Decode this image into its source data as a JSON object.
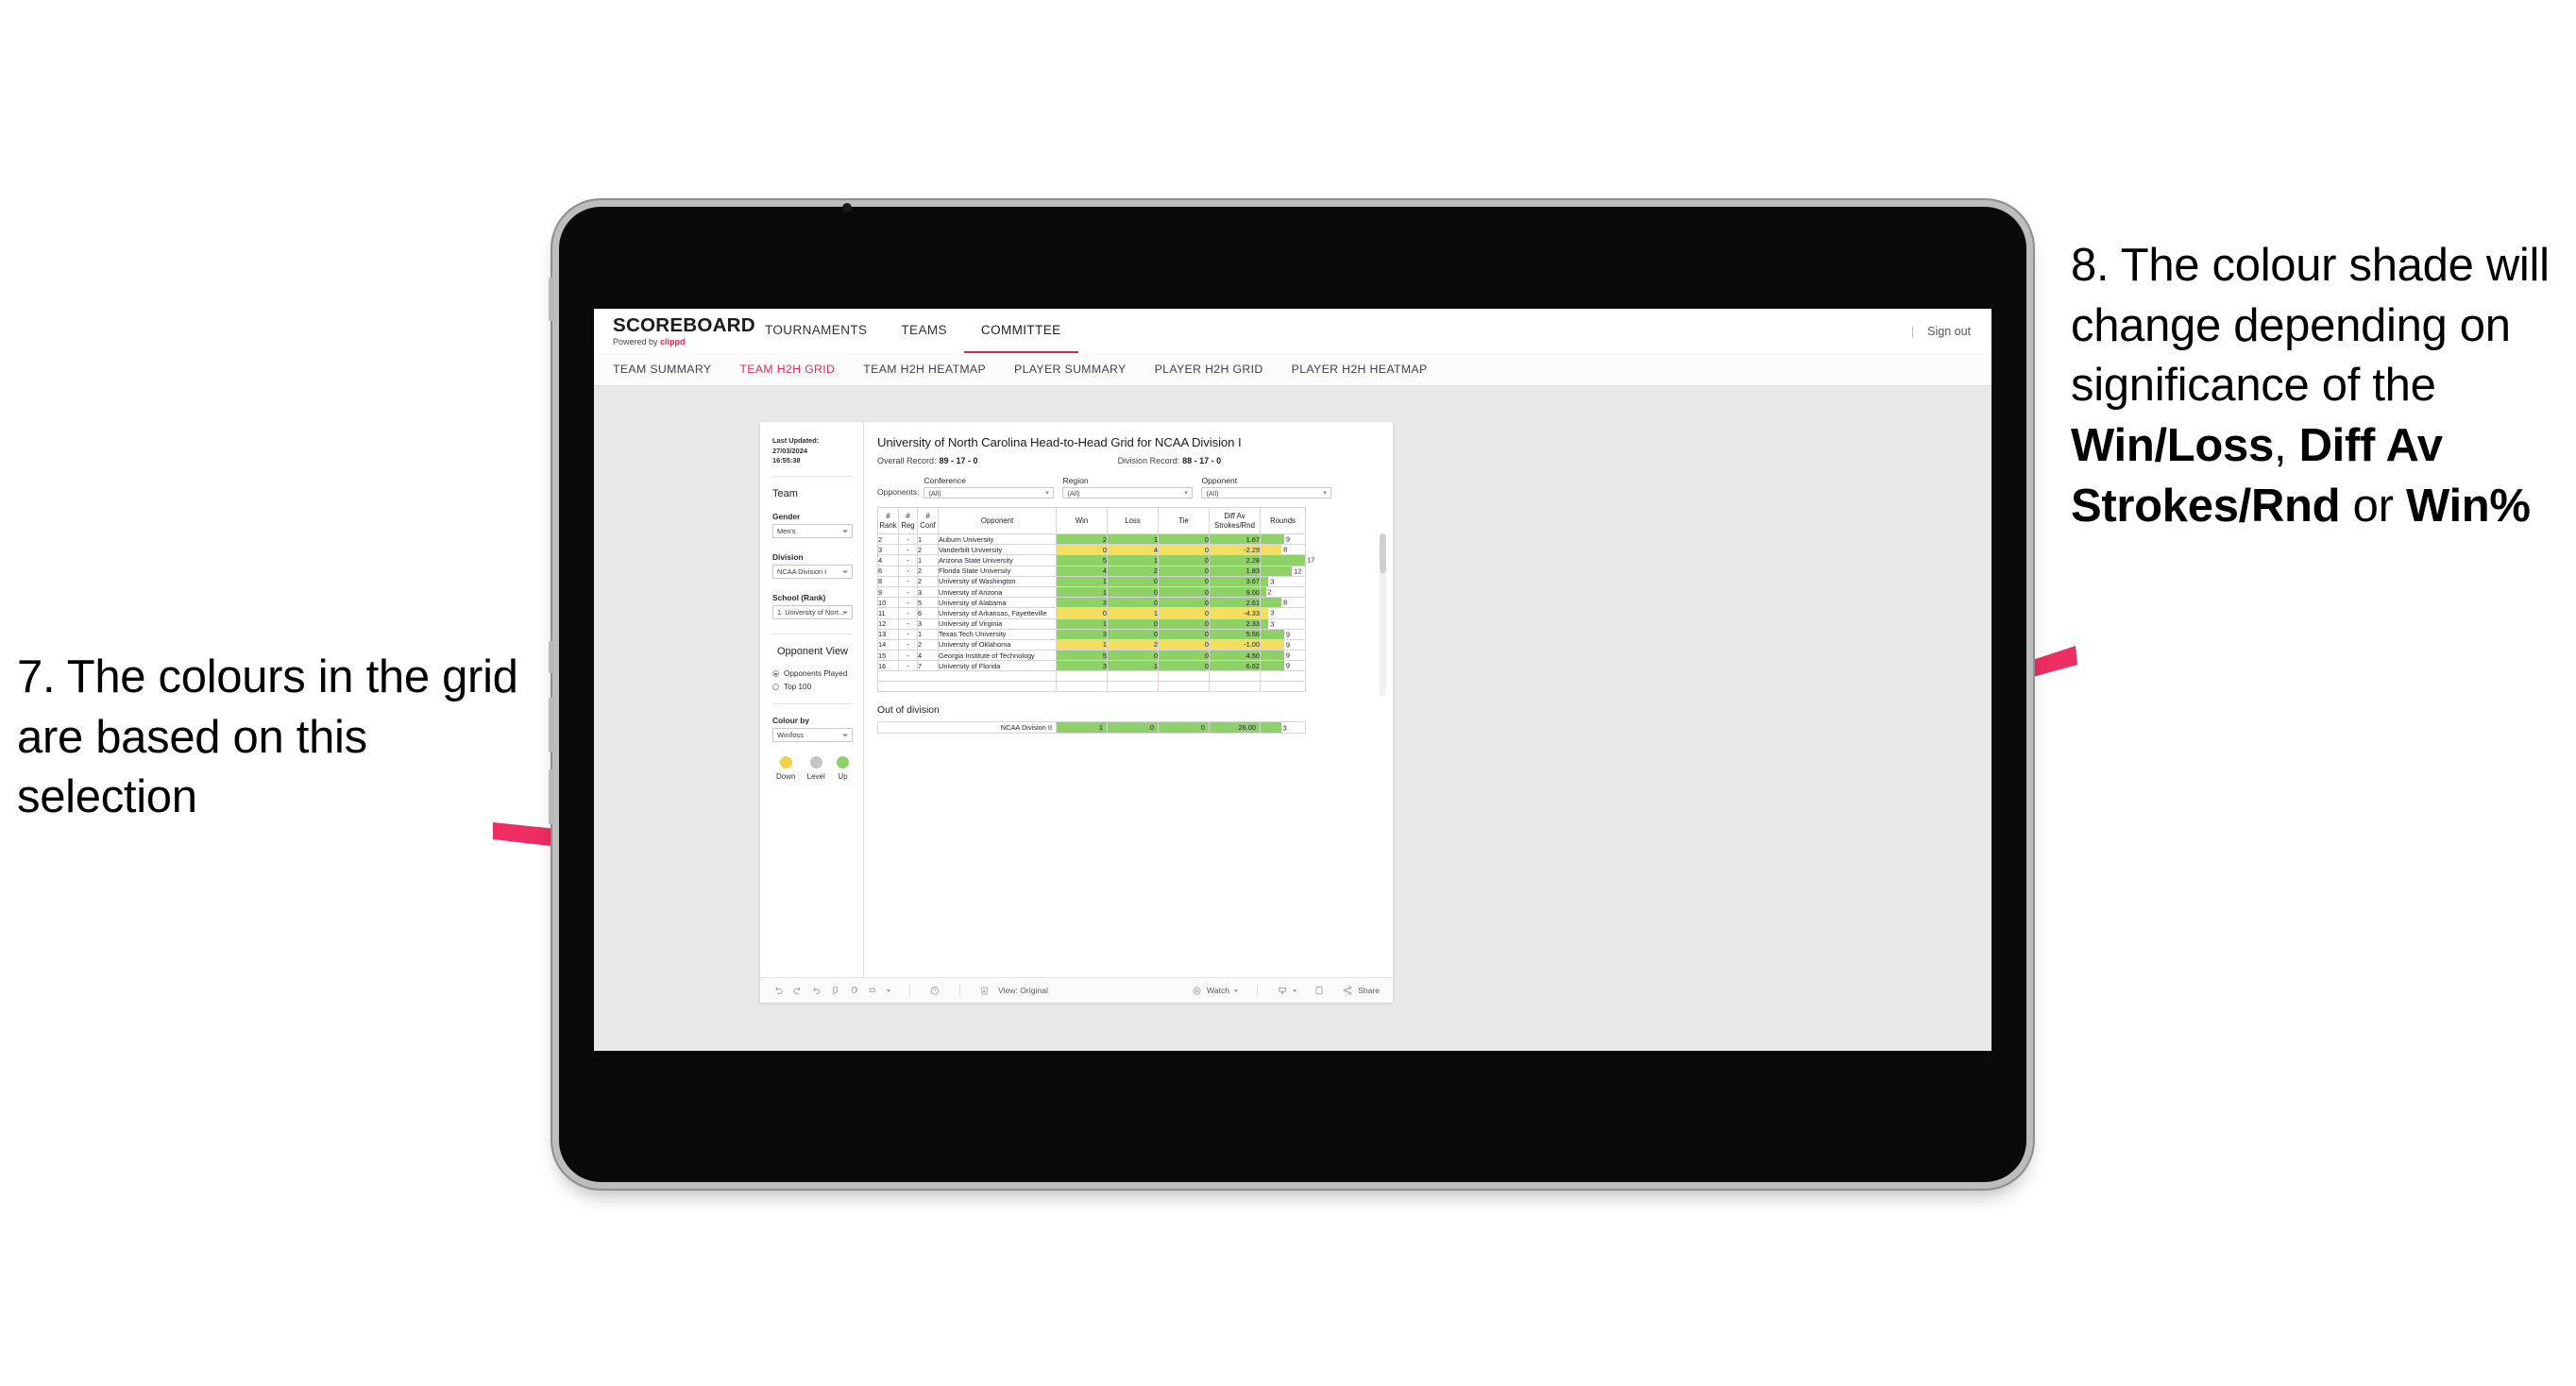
{
  "annotations": {
    "left": {
      "id": "annotation-7",
      "text": "7. The colours in the grid are based on this selection"
    },
    "right": {
      "id": "annotation-8",
      "prefix": "8. The colour shade will change depending on significance of the ",
      "bold1": "Win/Loss",
      "sep1": ", ",
      "bold2": "Diff Av Strokes/Rnd",
      "sep2": " or ",
      "bold3": "Win%"
    },
    "arrow_color": "#ee2d62"
  },
  "header": {
    "logo_title": "SCOREBOARD",
    "logo_powered": "Powered by",
    "logo_brand": "clippd",
    "nav": [
      {
        "label": "TOURNAMENTS",
        "active": false
      },
      {
        "label": "TEAMS",
        "active": false
      },
      {
        "label": "COMMITTEE",
        "active": true
      }
    ],
    "divider": "|",
    "signout": "Sign out",
    "accent": "#d5294f"
  },
  "subnav": [
    {
      "label": "TEAM SUMMARY",
      "active": false
    },
    {
      "label": "TEAM H2H GRID",
      "active": true
    },
    {
      "label": "TEAM H2H HEATMAP",
      "active": false
    },
    {
      "label": "PLAYER SUMMARY",
      "active": false
    },
    {
      "label": "PLAYER H2H GRID",
      "active": false
    },
    {
      "label": "PLAYER H2H HEATMAP",
      "active": false
    }
  ],
  "panel": {
    "last_updated_line1": "Last Updated: 27/03/2024",
    "last_updated_line2": "16:55:38",
    "team_title": "Team",
    "gender_label": "Gender",
    "gender_value": "Men's",
    "division_label": "Division",
    "division_value": "NCAA Division I",
    "school_label": "School (Rank)",
    "school_value": "1. University of Nort...",
    "opponent_view_title": "Opponent View",
    "opponent_view_options": [
      {
        "label": "Opponents Played",
        "selected": true
      },
      {
        "label": "Top 100",
        "selected": false
      }
    ],
    "colour_by_label": "Colour by",
    "colour_by_value": "Win/loss",
    "legend": [
      {
        "label": "Down",
        "color": "#f3d04e"
      },
      {
        "label": "Level",
        "color": "#c4c6c9"
      },
      {
        "label": "Up",
        "color": "#8ed167"
      }
    ]
  },
  "viz": {
    "title": "University of North Carolina Head-to-Head Grid for NCAA Division I",
    "overall_record_label": "Overall Record:",
    "overall_record_value": "89 - 17 - 0",
    "division_record_label": "Division Record:",
    "division_record_value": "88 - 17 - 0",
    "opponents_label": "Opponents:",
    "filters": [
      {
        "label": "Conference",
        "value": "(All)"
      },
      {
        "label": "Region",
        "value": "(All)"
      },
      {
        "label": "Opponent",
        "value": "(All)"
      }
    ],
    "out_of_division_title": "Out of division"
  },
  "chart_data": {
    "type": "table",
    "title": "University of North Carolina Head-to-Head Grid for NCAA Division I",
    "columns": [
      "# Rank",
      "# Reg",
      "# Conf",
      "Opponent",
      "Win",
      "Loss",
      "Tie",
      "Diff Av Strokes/Rnd",
      "Rounds"
    ],
    "column_headers_multiline": [
      [
        "#",
        "Rank"
      ],
      [
        "#",
        "Reg"
      ],
      [
        "#",
        "Conf"
      ],
      [
        "Opponent"
      ],
      [
        "Win"
      ],
      [
        "Loss"
      ],
      [
        "Tie"
      ],
      [
        "Diff Av",
        "Strokes/Rnd"
      ],
      [
        "Rounds"
      ]
    ],
    "rounds_max": 17,
    "colors": {
      "up": "#8ed167",
      "down": "#f3de5e",
      "level": "#c4c6c9"
    },
    "rows": [
      {
        "rank": "2",
        "reg": "-",
        "conf": "1",
        "opponent": "Auburn University",
        "win": 2,
        "loss": 1,
        "tie": 0,
        "diff": "1.67",
        "rounds": 9,
        "state": "up"
      },
      {
        "rank": "3",
        "reg": "-",
        "conf": "2",
        "opponent": "Vanderbilt University",
        "win": 0,
        "loss": 4,
        "tie": 0,
        "diff": "-2.29",
        "rounds": 8,
        "state": "down"
      },
      {
        "rank": "4",
        "reg": "-",
        "conf": "1",
        "opponent": "Arizona State University",
        "win": 5,
        "loss": 1,
        "tie": 0,
        "diff": "2.28",
        "rounds": 17,
        "state": "up"
      },
      {
        "rank": "6",
        "reg": "-",
        "conf": "2",
        "opponent": "Florida State University",
        "win": 4,
        "loss": 2,
        "tie": 0,
        "diff": "1.83",
        "rounds": 12,
        "state": "up"
      },
      {
        "rank": "8",
        "reg": "-",
        "conf": "2",
        "opponent": "University of Washington",
        "win": 1,
        "loss": 0,
        "tie": 0,
        "diff": "3.67",
        "rounds": 3,
        "state": "up"
      },
      {
        "rank": "9",
        "reg": "-",
        "conf": "3",
        "opponent": "University of Arizona",
        "win": 1,
        "loss": 0,
        "tie": 0,
        "diff": "9.00",
        "rounds": 2,
        "state": "up"
      },
      {
        "rank": "10",
        "reg": "-",
        "conf": "5",
        "opponent": "University of Alabama",
        "win": 3,
        "loss": 0,
        "tie": 0,
        "diff": "2.61",
        "rounds": 8,
        "state": "up"
      },
      {
        "rank": "11",
        "reg": "-",
        "conf": "6",
        "opponent": "University of Arkansas, Fayetteville",
        "win": 0,
        "loss": 1,
        "tie": 0,
        "diff": "-4.33",
        "rounds": 3,
        "state": "down"
      },
      {
        "rank": "12",
        "reg": "-",
        "conf": "3",
        "opponent": "University of Virginia",
        "win": 1,
        "loss": 0,
        "tie": 0,
        "diff": "2.33",
        "rounds": 3,
        "state": "up"
      },
      {
        "rank": "13",
        "reg": "-",
        "conf": "1",
        "opponent": "Texas Tech University",
        "win": 3,
        "loss": 0,
        "tie": 0,
        "diff": "5.56",
        "rounds": 9,
        "state": "up"
      },
      {
        "rank": "14",
        "reg": "-",
        "conf": "2",
        "opponent": "University of Oklahoma",
        "win": 1,
        "loss": 2,
        "tie": 0,
        "diff": "-1.00",
        "rounds": 9,
        "state": "down"
      },
      {
        "rank": "15",
        "reg": "-",
        "conf": "4",
        "opponent": "Georgia Institute of Technology",
        "win": 5,
        "loss": 0,
        "tie": 0,
        "diff": "4.50",
        "rounds": 9,
        "state": "up"
      },
      {
        "rank": "16",
        "reg": "-",
        "conf": "7",
        "opponent": "University of Florida",
        "win": 3,
        "loss": 1,
        "tie": 0,
        "diff": "6.62",
        "rounds": 9,
        "state": "up"
      }
    ],
    "out_of_division_rows": [
      {
        "opponent": "NCAA Division II",
        "win": 1,
        "loss": 0,
        "tie": 0,
        "diff": "26.00",
        "rounds": 3,
        "state": "up"
      }
    ]
  },
  "toolbar": {
    "view_label": "View: Original",
    "watch_label": "Watch",
    "share_label": "Share",
    "icons": [
      "undo-icon",
      "redo-icon",
      "revert-icon",
      "refresh-data-icon",
      "pause-icon",
      "export-icon",
      "timer-icon",
      "view-original-icon",
      "watch-icon",
      "download-icon",
      "fullscreen-icon",
      "share-icon"
    ]
  }
}
